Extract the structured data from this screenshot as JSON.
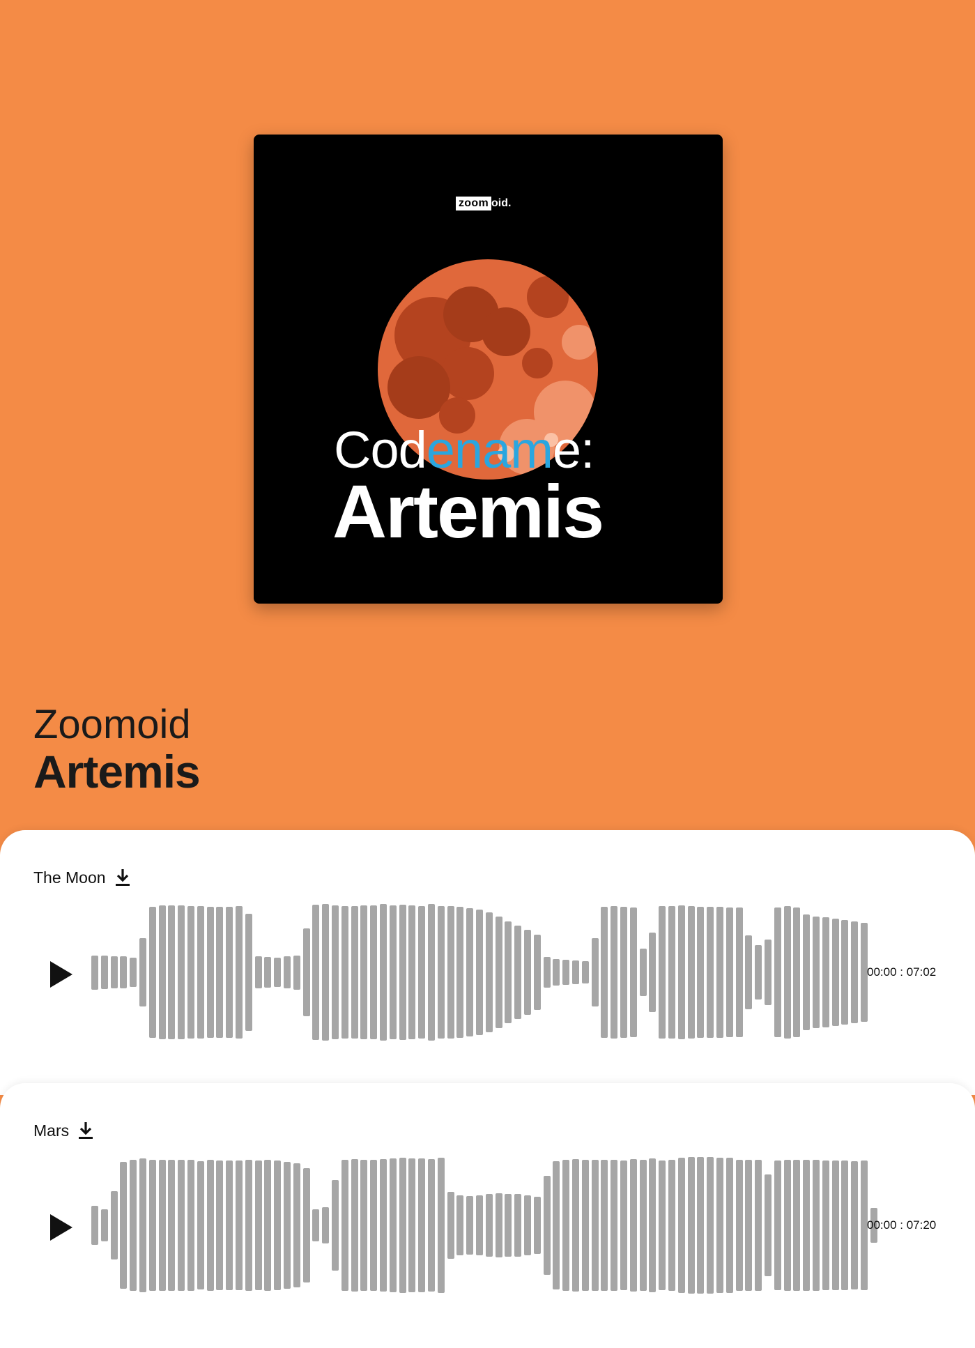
{
  "cover": {
    "logo_boxed": "zoom",
    "logo_rest": "oid.",
    "line1_prefix": "Cod",
    "line1_highlight": "enam",
    "line1_suffix": "e:",
    "line2": "Artemis",
    "highlight_color": "#2aa6df",
    "moon_color": "#e0683b"
  },
  "header": {
    "artist": "Zoomoid",
    "album": "Artemis"
  },
  "colors": {
    "background": "#f48b46",
    "waveform_bar": "#a6a6a6"
  },
  "tracks": [
    {
      "title": "The Moon",
      "time": "00:00 : 07:02",
      "waveform": [
        0.25,
        0.24,
        0.23,
        0.23,
        0.21,
        0.5,
        0.96,
        0.98,
        0.98,
        0.98,
        0.97,
        0.97,
        0.96,
        0.96,
        0.96,
        0.97,
        0.86,
        0.23,
        0.22,
        0.21,
        0.23,
        0.25,
        0.64,
        0.99,
        1.0,
        0.98,
        0.97,
        0.97,
        0.98,
        0.98,
        1.0,
        0.98,
        0.99,
        0.98,
        0.97,
        1.0,
        0.97,
        0.97,
        0.96,
        0.94,
        0.92,
        0.88,
        0.82,
        0.74,
        0.68,
        0.62,
        0.55,
        0.22,
        0.19,
        0.18,
        0.17,
        0.16,
        0.5,
        0.96,
        0.97,
        0.96,
        0.95,
        0.35,
        0.58,
        0.97,
        0.97,
        0.98,
        0.97,
        0.96,
        0.96,
        0.96,
        0.95,
        0.95,
        0.54,
        0.4,
        0.48,
        0.95,
        0.97,
        0.95,
        0.85,
        0.82,
        0.81,
        0.79,
        0.77,
        0.74,
        0.72
      ]
    },
    {
      "title": "Mars",
      "time": "00:00 : 07:20",
      "waveform": [
        0.29,
        0.23,
        0.5,
        0.93,
        0.96,
        0.98,
        0.96,
        0.96,
        0.96,
        0.96,
        0.96,
        0.94,
        0.96,
        0.95,
        0.95,
        0.95,
        0.96,
        0.95,
        0.96,
        0.95,
        0.93,
        0.91,
        0.84,
        0.23,
        0.27,
        0.66,
        0.96,
        0.97,
        0.96,
        0.96,
        0.97,
        0.98,
        0.99,
        0.98,
        0.98,
        0.97,
        0.99,
        0.49,
        0.44,
        0.43,
        0.44,
        0.46,
        0.47,
        0.46,
        0.46,
        0.44,
        0.42,
        0.72,
        0.94,
        0.96,
        0.97,
        0.96,
        0.96,
        0.96,
        0.96,
        0.95,
        0.97,
        0.96,
        0.98,
        0.95,
        0.96,
        0.99,
        1.0,
        1.0,
        1.0,
        0.99,
        0.99,
        0.96,
        0.96,
        0.96,
        0.74,
        0.95,
        0.96,
        0.96,
        0.96,
        0.96,
        0.95,
        0.95,
        0.95,
        0.94,
        0.95,
        0.26
      ]
    }
  ]
}
